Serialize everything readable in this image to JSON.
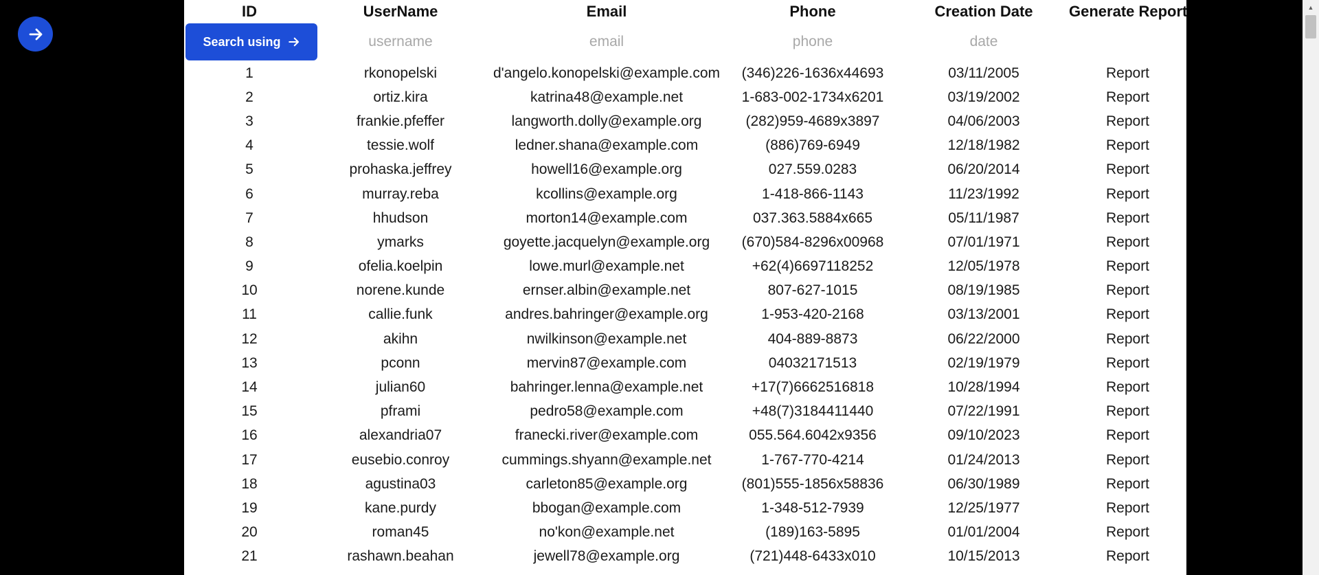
{
  "colors": {
    "accent": "#1d4ed8",
    "background": "#000000",
    "panel": "#ffffff",
    "placeholder": "#a8a8a8"
  },
  "nav": {
    "forward_icon": "arrow-right-icon"
  },
  "table": {
    "headers": {
      "id": "ID",
      "username": "UserName",
      "email": "Email",
      "phone": "Phone",
      "creation_date": "Creation Date",
      "report": "Generate Report"
    },
    "filters": {
      "search_button_label": "Search using",
      "username_placeholder": "username",
      "email_placeholder": "email",
      "phone_placeholder": "phone",
      "date_placeholder": "date"
    },
    "rows": [
      {
        "id": "1",
        "username": "rkonopelski",
        "email": "d'angelo.konopelski@example.com",
        "phone": "(346)226-1636x44693",
        "date": "03/11/2005",
        "report": "Report"
      },
      {
        "id": "2",
        "username": "ortiz.kira",
        "email": "katrina48@example.net",
        "phone": "1-683-002-1734x6201",
        "date": "03/19/2002",
        "report": "Report"
      },
      {
        "id": "3",
        "username": "frankie.pfeffer",
        "email": "langworth.dolly@example.org",
        "phone": "(282)959-4689x3897",
        "date": "04/06/2003",
        "report": "Report"
      },
      {
        "id": "4",
        "username": "tessie.wolf",
        "email": "ledner.shana@example.com",
        "phone": "(886)769-6949",
        "date": "12/18/1982",
        "report": "Report"
      },
      {
        "id": "5",
        "username": "prohaska.jeffrey",
        "email": "howell16@example.org",
        "phone": "027.559.0283",
        "date": "06/20/2014",
        "report": "Report"
      },
      {
        "id": "6",
        "username": "murray.reba",
        "email": "kcollins@example.org",
        "phone": "1-418-866-1143",
        "date": "11/23/1992",
        "report": "Report"
      },
      {
        "id": "7",
        "username": "hhudson",
        "email": "morton14@example.com",
        "phone": "037.363.5884x665",
        "date": "05/11/1987",
        "report": "Report"
      },
      {
        "id": "8",
        "username": "ymarks",
        "email": "goyette.jacquelyn@example.org",
        "phone": "(670)584-8296x00968",
        "date": "07/01/1971",
        "report": "Report"
      },
      {
        "id": "9",
        "username": "ofelia.koelpin",
        "email": "lowe.murl@example.net",
        "phone": "+62(4)6697118252",
        "date": "12/05/1978",
        "report": "Report"
      },
      {
        "id": "10",
        "username": "norene.kunde",
        "email": "ernser.albin@example.net",
        "phone": "807-627-1015",
        "date": "08/19/1985",
        "report": "Report"
      },
      {
        "id": "11",
        "username": "callie.funk",
        "email": "andres.bahringer@example.org",
        "phone": "1-953-420-2168",
        "date": "03/13/2001",
        "report": "Report"
      },
      {
        "id": "12",
        "username": "akihn",
        "email": "nwilkinson@example.net",
        "phone": "404-889-8873",
        "date": "06/22/2000",
        "report": "Report"
      },
      {
        "id": "13",
        "username": "pconn",
        "email": "mervin87@example.com",
        "phone": "04032171513",
        "date": "02/19/1979",
        "report": "Report"
      },
      {
        "id": "14",
        "username": "julian60",
        "email": "bahringer.lenna@example.net",
        "phone": "+17(7)6662516818",
        "date": "10/28/1994",
        "report": "Report"
      },
      {
        "id": "15",
        "username": "pframi",
        "email": "pedro58@example.com",
        "phone": "+48(7)3184411440",
        "date": "07/22/1991",
        "report": "Report"
      },
      {
        "id": "16",
        "username": "alexandria07",
        "email": "franecki.river@example.com",
        "phone": "055.564.6042x9356",
        "date": "09/10/2023",
        "report": "Report"
      },
      {
        "id": "17",
        "username": "eusebio.conroy",
        "email": "cummings.shyann@example.net",
        "phone": "1-767-770-4214",
        "date": "01/24/2013",
        "report": "Report"
      },
      {
        "id": "18",
        "username": "agustina03",
        "email": "carleton85@example.org",
        "phone": "(801)555-1856x58836",
        "date": "06/30/1989",
        "report": "Report"
      },
      {
        "id": "19",
        "username": "kane.purdy",
        "email": "bbogan@example.com",
        "phone": "1-348-512-7939",
        "date": "12/25/1977",
        "report": "Report"
      },
      {
        "id": "20",
        "username": "roman45",
        "email": "no'kon@example.net",
        "phone": "(189)163-5895",
        "date": "01/01/2004",
        "report": "Report"
      },
      {
        "id": "21",
        "username": "rashawn.beahan",
        "email": "jewell78@example.org",
        "phone": "(721)448-6433x010",
        "date": "10/15/2013",
        "report": "Report"
      }
    ]
  }
}
